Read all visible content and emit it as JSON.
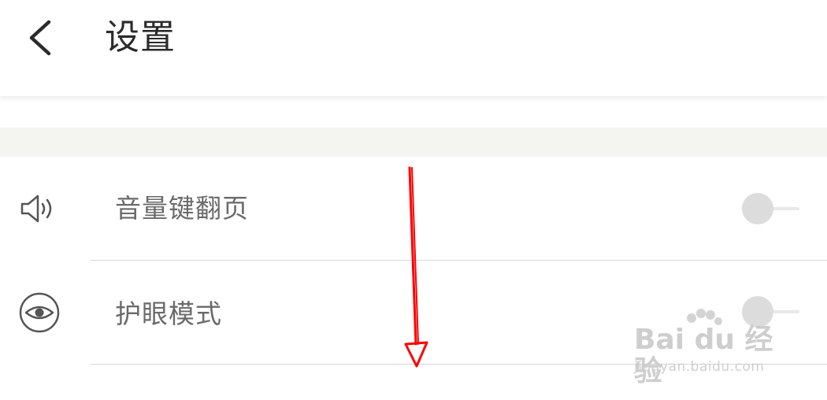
{
  "header": {
    "back_icon": "chevron-left-icon",
    "title": "设置"
  },
  "settings": [
    {
      "icon": "speaker-volume-icon",
      "label": "音量键翻页",
      "enabled": false
    },
    {
      "icon": "eye-icon",
      "label": "护眼模式",
      "enabled": false
    }
  ],
  "annotation": {
    "color": "#ff0000",
    "shape": "arrow-down"
  },
  "watermark": {
    "brand": "Bai du 经验",
    "url": "jingyan.baidu.com"
  },
  "colors": {
    "section_bar": "#f4f4f1",
    "divider": "#d6d6d6",
    "toggle_off": "#dcdcdc"
  }
}
